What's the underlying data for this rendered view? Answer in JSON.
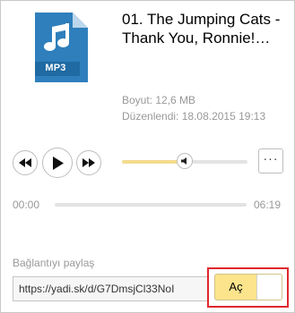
{
  "file": {
    "icon": "mp3-file-icon",
    "type_label": "MP3",
    "title": "01. The Jumping Cats - Thank You, Ronnie!…",
    "size": "Boyut: 12,6 MB",
    "modified": "Düzenlendi: 18.08.2015 19:13"
  },
  "player": {
    "prev_icon": "rewind-icon",
    "play_icon": "play-icon",
    "next_icon": "fast-forward-icon",
    "volume_icon": "speaker-icon",
    "volume_level": 0.5,
    "more_label": "···",
    "current_time": "00:00",
    "duration": "06:19",
    "progress": 0
  },
  "share": {
    "label": "Bağlantıyı paylaş",
    "url": "https://yadi.sk/d/G7DmsjCl33NoI",
    "toggle_label": "Aç",
    "toggle_on": true
  },
  "colors": {
    "accent": "#fbe48c",
    "volume_fill": "#f3dc8e",
    "icon_blue": "#2e7fbc",
    "icon_dark": "#1f6aa2",
    "highlight": "#e0262c"
  }
}
